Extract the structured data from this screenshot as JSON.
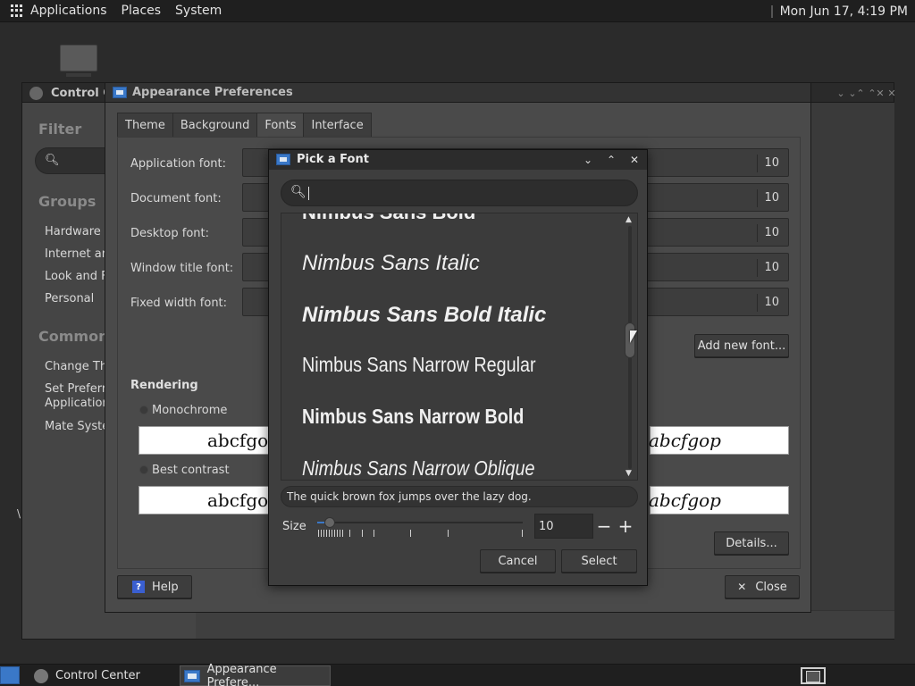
{
  "top_panel": {
    "menus": [
      "Applications",
      "Places",
      "System"
    ],
    "clock": "Mon Jun 17,  4:19 PM"
  },
  "control_center": {
    "title": "Control C",
    "filter_heading": "Filter",
    "groups_heading": "Groups",
    "groups": [
      "Hardware",
      "Internet an",
      "Look and F",
      "Personal"
    ],
    "common_heading": "Common T",
    "common_items": [
      "Change Th",
      "Set Preferre\nApplication",
      "Mate Syster"
    ],
    "stray_letter": "\\"
  },
  "appearance": {
    "title": "Appearance Preferences",
    "tabs": [
      {
        "label": "Theme",
        "active": false
      },
      {
        "label": "Background",
        "active": false
      },
      {
        "label": "Fonts",
        "active": true
      },
      {
        "label": "Interface",
        "active": false
      }
    ],
    "font_rows": [
      {
        "label": "Application font:",
        "size": "10"
      },
      {
        "label": "Document font:",
        "size": "10"
      },
      {
        "label": "Desktop font:",
        "size": "10"
      },
      {
        "label": "Window title font:",
        "size": "10"
      },
      {
        "label": "Fixed width font:",
        "size": "10"
      }
    ],
    "add_new_font": "Add new font...",
    "rendering_heading": "Rendering",
    "rendering_options": [
      {
        "label": "Monochrome",
        "sample_left": "abcfgop",
        "sample_right": "abcfgop"
      },
      {
        "label": "Best contrast",
        "sample_left": "abcfgop",
        "sample_right": "abcfgop"
      }
    ],
    "details": "Details...",
    "help": "Help",
    "close": "Close"
  },
  "font_dialog": {
    "title": "Pick a Font",
    "search_value": "",
    "fonts": [
      {
        "name": "Nimbus Sans Bold",
        "style": "bold"
      },
      {
        "name": "Nimbus Sans Italic",
        "style": "italic"
      },
      {
        "name": "Nimbus Sans Bold Italic",
        "style": "bold-italic"
      },
      {
        "name": "Nimbus Sans Narrow Regular",
        "style": "narrow"
      },
      {
        "name": "Nimbus Sans Narrow Bold",
        "style": "narrow-bold"
      },
      {
        "name": "Nimbus Sans Narrow Oblique",
        "style": "narrow-italic"
      }
    ],
    "preview_text": "The quick brown fox jumps over the lazy dog.",
    "size_label": "Size",
    "size_value": "10",
    "minus": "−",
    "plus": "+",
    "cancel": "Cancel",
    "select": "Select"
  },
  "taskbar": {
    "tasks": [
      "Control Center",
      "Appearance Prefere..."
    ]
  },
  "colors": {
    "accent": "#3a78c8",
    "panel": "#1f1f1f",
    "window": "#4a4a4a"
  }
}
